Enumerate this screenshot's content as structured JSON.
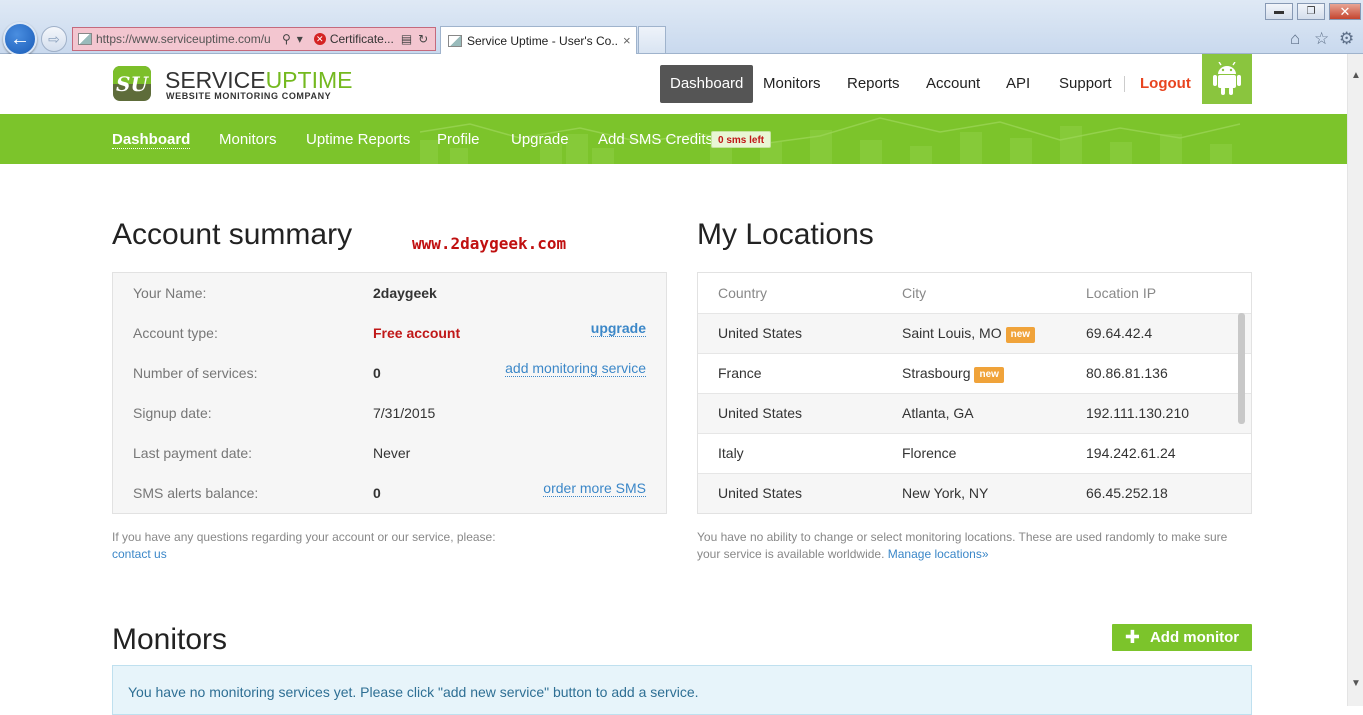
{
  "browser": {
    "url": "https://www.serviceuptime.com/u",
    "certificate_label": "Certificate...",
    "tab_title": "Service Uptime - User's Co...",
    "tab_close": "×",
    "window_minimize": "▬",
    "window_restore": "❐",
    "window_close": "✕"
  },
  "site": {
    "logo_text_1": "SERVICE",
    "logo_text_2": "UPTIME",
    "logo_tagline": "WEBSITE MONITORING COMPANY",
    "logo_mark": "SU",
    "accent_color": "#7cc42b"
  },
  "topnav": {
    "items": [
      "Dashboard",
      "Monitors",
      "Reports",
      "Account",
      "API",
      "Support"
    ],
    "logout": "Logout",
    "active": "Dashboard"
  },
  "subnav": {
    "items": [
      "Dashboard",
      "Monitors",
      "Uptime Reports",
      "Profile",
      "Upgrade",
      "Add SMS Credits"
    ],
    "sms_badge": "0 sms left"
  },
  "account_summary": {
    "title": "Account summary",
    "watermark": "www.2daygeek.com",
    "rows": [
      {
        "label": "Your Name:",
        "value": "2daygeek"
      },
      {
        "label": "Account type:",
        "value": "Free account",
        "link": "upgrade"
      },
      {
        "label": "Number of services:",
        "value": "0",
        "link": "add monitoring service"
      },
      {
        "label": "Signup date:",
        "value": "7/31/2015"
      },
      {
        "label": "Last payment date:",
        "value": "Never"
      },
      {
        "label": "SMS alerts balance:",
        "value": "0",
        "link": "order more SMS"
      }
    ],
    "note": "If you have any questions regarding your account or our service, please:",
    "note_link": "contact us"
  },
  "locations": {
    "title": "My Locations",
    "columns": [
      "Country",
      "City",
      "Location IP"
    ],
    "rows": [
      {
        "country": "United States",
        "city": "Saint Louis, MO",
        "badge": "new",
        "ip": "69.64.42.4"
      },
      {
        "country": "France",
        "city": "Strasbourg",
        "badge": "new",
        "ip": "80.86.81.136"
      },
      {
        "country": "United States",
        "city": "Atlanta, GA",
        "badge": "",
        "ip": "192.111.130.210"
      },
      {
        "country": "Italy",
        "city": "Florence",
        "badge": "",
        "ip": "194.242.61.24"
      },
      {
        "country": "United States",
        "city": "New York, NY",
        "badge": "",
        "ip": "66.45.252.18"
      }
    ],
    "note_line1": "You have no ability to change or select monitoring locations. These are used randomly to make sure",
    "note_line2": "your service is available worldwide.",
    "note_link": "Manage locations»"
  },
  "monitors": {
    "title": "Monitors",
    "add_button": "Add monitor",
    "empty_message": "You have no monitoring services yet. Please click \"add new service\" button to add a service."
  }
}
